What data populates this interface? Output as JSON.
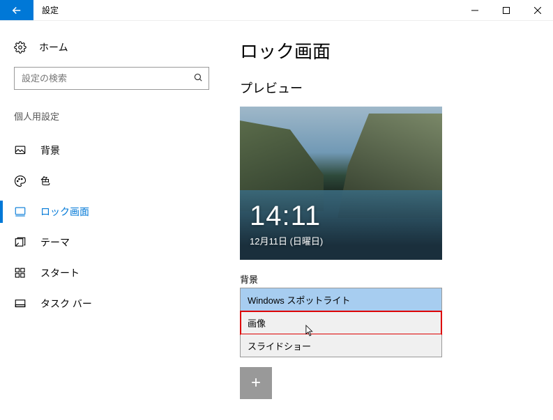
{
  "titlebar": {
    "title": "設定"
  },
  "sidebar": {
    "home": "ホーム",
    "search_placeholder": "設定の検索",
    "section": "個人用設定",
    "items": [
      {
        "label": "背景"
      },
      {
        "label": "色"
      },
      {
        "label": "ロック画面"
      },
      {
        "label": "テーマ"
      },
      {
        "label": "スタート"
      },
      {
        "label": "タスク バー"
      }
    ]
  },
  "content": {
    "title": "ロック画面",
    "preview_label": "プレビュー",
    "clock": "14:11",
    "date": "12月11日 (日曜日)",
    "bg_label": "背景",
    "dropdown": {
      "options": [
        {
          "label": "Windows スポットライト"
        },
        {
          "label": "画像"
        },
        {
          "label": "スライドショー"
        }
      ]
    }
  }
}
